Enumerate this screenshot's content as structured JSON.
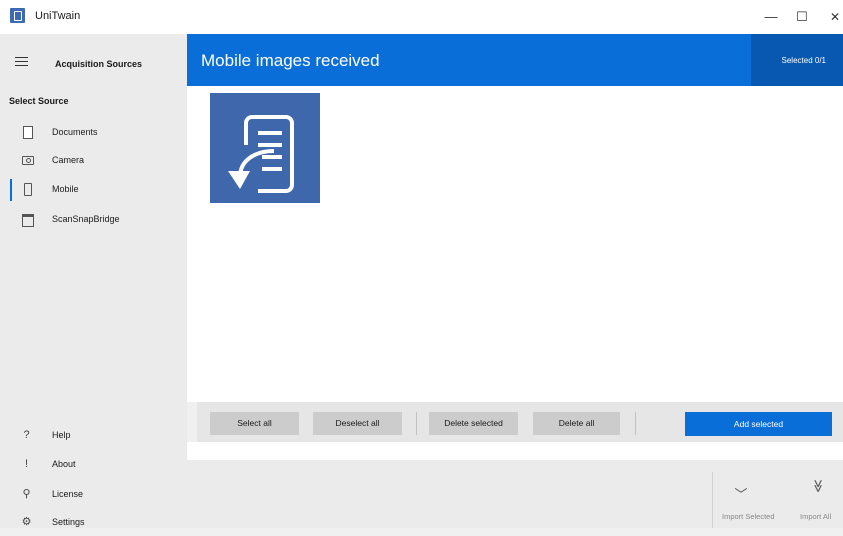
{
  "window": {
    "title": "UniTwain",
    "minimize": "—",
    "maximize": "☐",
    "close": "✕"
  },
  "sidebar": {
    "menu_icon": "hamburger-menu-icon",
    "header": "Acquisition Sources",
    "section": "Select Source",
    "items": [
      {
        "label": "Documents",
        "icon": "document-icon"
      },
      {
        "label": "Camera",
        "icon": "camera-icon"
      },
      {
        "label": "Mobile",
        "icon": "mobile-icon",
        "active": true
      },
      {
        "label": "ScanSnapBridge",
        "icon": "scanner-icon"
      }
    ],
    "bottom_items": [
      {
        "label": "Help",
        "glyph": "?"
      },
      {
        "label": "About",
        "glyph": "!"
      },
      {
        "label": "License",
        "glyph": "⚲"
      },
      {
        "label": "Settings",
        "glyph": "⚙"
      }
    ]
  },
  "header": {
    "title": "Mobile images received",
    "selected": "Selected 0/1"
  },
  "actions": {
    "select_all": "Select all",
    "deselect_all": "Deselect all",
    "delete_selected": "Delete selected",
    "delete_all": "Delete all",
    "add_selected": "Add selected"
  },
  "footer": {
    "import_selected": "Import Selected",
    "import_all": "Import All",
    "import_selected_glyph": "﹀",
    "import_all_glyph": "≫"
  },
  "colors": {
    "accent": "#0a6ed9",
    "accent_dark": "#0858b2",
    "thumb": "#3f67ac"
  }
}
